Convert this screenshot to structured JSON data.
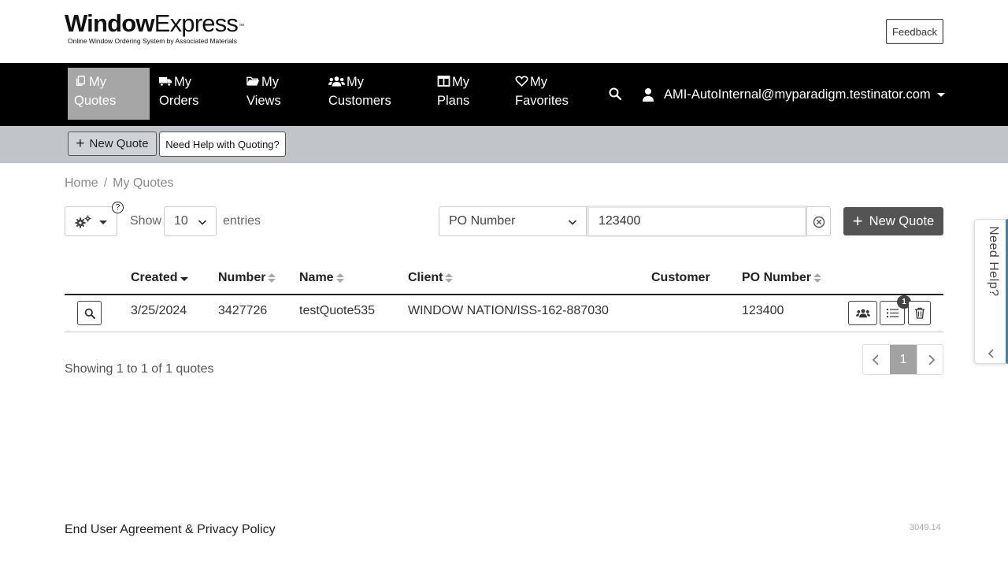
{
  "header": {
    "logo_bold": "Window",
    "logo_light": "Express",
    "logo_tm": "™",
    "logo_tagline": "Online Window Ordering System by Associated Materials",
    "feedback_label": "Feedback"
  },
  "nav": {
    "items": [
      {
        "label_top": "My",
        "label_bottom": "Quotes",
        "icon": "copy-icon",
        "active": true
      },
      {
        "label_top": "My",
        "label_bottom": "Orders",
        "icon": "truck-icon",
        "active": false
      },
      {
        "label_top": "My",
        "label_bottom": "Views",
        "icon": "folder-open-icon",
        "active": false
      },
      {
        "label_top": "My",
        "label_bottom": "Customers",
        "icon": "users-icon",
        "active": false
      },
      {
        "label_top": "My",
        "label_bottom": "Plans",
        "icon": "columns-icon",
        "active": false
      },
      {
        "label_top": "My",
        "label_bottom": "Favorites",
        "icon": "heart-icon",
        "active": false
      }
    ],
    "user_email": "AMI-AutoInternal@myparadigm.testinator.com"
  },
  "subbar": {
    "new_quote_label": "New Quote",
    "help_label": "Need Help with Quoting?"
  },
  "breadcrumb": {
    "home": "Home",
    "separator": "/",
    "current": "My Quotes"
  },
  "toolbar": {
    "help_marker": "?",
    "show_label": "Show",
    "page_size": "10",
    "entries_label": "entries",
    "filter_field": "PO Number",
    "filter_value": "123400",
    "new_quote_label": "New Quote"
  },
  "table": {
    "columns": [
      "Created",
      "Number",
      "Name",
      "Client",
      "Customer",
      "PO Number"
    ],
    "sorted_column": "Created",
    "sort_direction": "desc",
    "rows": [
      {
        "created": "3/25/2024",
        "number": "3427726",
        "name": "testQuote535",
        "client": "WINDOW NATION/ISS-162-887030",
        "customer": "",
        "po_number": "123400",
        "list_badge": "1"
      }
    ]
  },
  "pagination": {
    "summary": "Showing 1 to 1 of 1 quotes",
    "current_page": "1"
  },
  "help_tab": {
    "label": "Need Help?"
  },
  "footer": {
    "agreement_link": "End User Agreement & Privacy Policy",
    "version": "3049.14"
  },
  "colors": {
    "nav_bg": "#000000",
    "nav_active": "#a6a6a6",
    "subbar_bg": "#c1c4c8",
    "primary_button": "#545454",
    "help_tab_accent": "#2a88c8"
  }
}
